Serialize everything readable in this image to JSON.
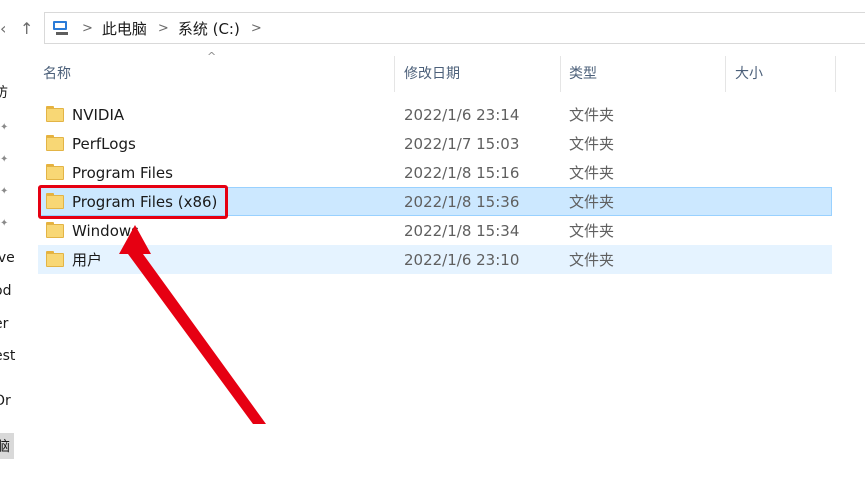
{
  "nav": {
    "back_icon": "chevron-left-icon",
    "up_icon": "arrow-up-icon",
    "up_glyph": "↑"
  },
  "breadcrumb": {
    "items": [
      "此电脑",
      "系统 (C:)"
    ],
    "separator": ">"
  },
  "left_nav": {
    "fragments": [
      "访",
      "ive",
      "od",
      "er",
      "est",
      "Or",
      "脑"
    ]
  },
  "columns": {
    "name": "名称",
    "date": "修改日期",
    "type": "类型",
    "size": "大小"
  },
  "files": [
    {
      "name": "NVIDIA",
      "date": "2022/1/6 23:14",
      "type": "文件夹"
    },
    {
      "name": "PerfLogs",
      "date": "2022/1/7 15:03",
      "type": "文件夹"
    },
    {
      "name": "Program Files",
      "date": "2022/1/8 15:16",
      "type": "文件夹"
    },
    {
      "name": "Program Files (x86)",
      "date": "2022/1/8 15:36",
      "type": "文件夹",
      "selected": true
    },
    {
      "name": "Windows",
      "date": "2022/1/8 15:34",
      "type": "文件夹"
    },
    {
      "name": "用户",
      "date": "2022/1/6 23:10",
      "type": "文件夹",
      "hover": true
    }
  ],
  "colors": {
    "selected_bg": "#cce8ff",
    "hover_bg": "#e5f3ff",
    "annotation": "#e60012",
    "folder": "#f8d775"
  }
}
